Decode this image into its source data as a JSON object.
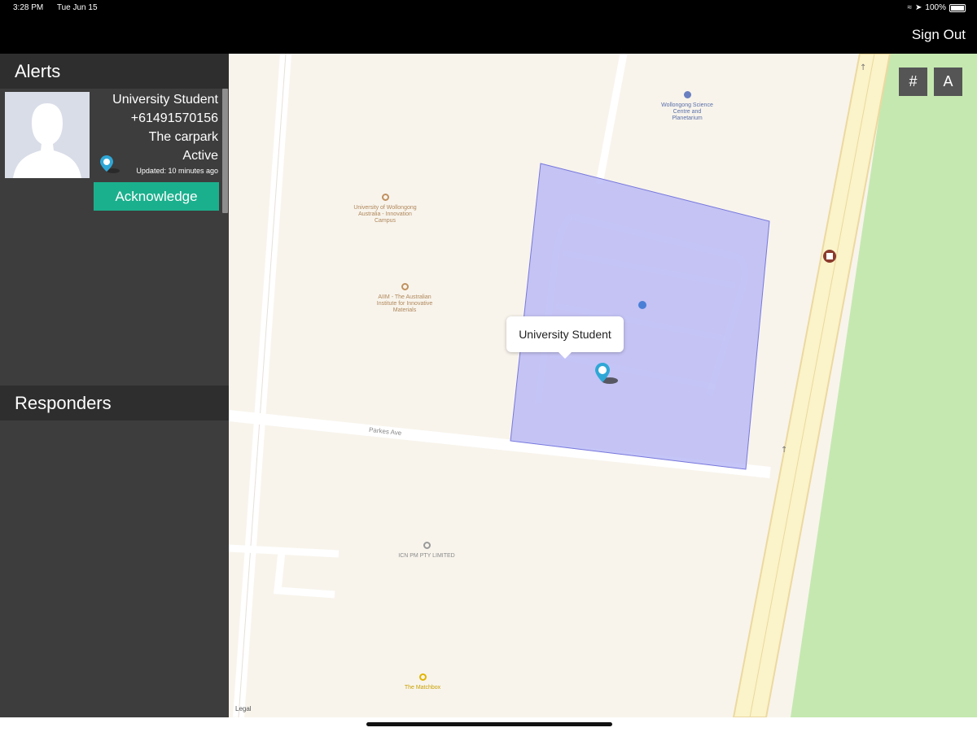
{
  "status_bar": {
    "time": "3:28 PM",
    "date": "Tue Jun 15",
    "battery": "100%"
  },
  "nav": {
    "sign_out_label": "Sign Out"
  },
  "sidebar": {
    "alerts_title": "Alerts",
    "alert": {
      "name": "University Student",
      "phone": "+61491570156",
      "location": "The carpark",
      "status": "Active",
      "updated": "Updated: 10 minutes ago",
      "acknowledge_label": "Acknowledge"
    },
    "responders_title": "Responders"
  },
  "map": {
    "grid_button_label": "#",
    "text_button_label": "A",
    "callout_label": "University Student",
    "street_label": "Parkes Ave",
    "legal_label": "Legal",
    "pois": {
      "science_centre": "Wollongong Science Centre and Planetarium",
      "uow_innovation": "University of Wollongong Australia - Innovation Campus",
      "aiim": "AIIM - The Australian Institute for Innovative Materials",
      "icn": "ICN PM PTY LIMITED",
      "matchbox": "The Matchbox"
    },
    "colors": {
      "geofence_fill": "#b6b6f5",
      "geofence_stroke": "#7777dd",
      "park": "#c5e8b0",
      "land": "#f8f4ec",
      "pin": "#2fa7d6"
    }
  }
}
